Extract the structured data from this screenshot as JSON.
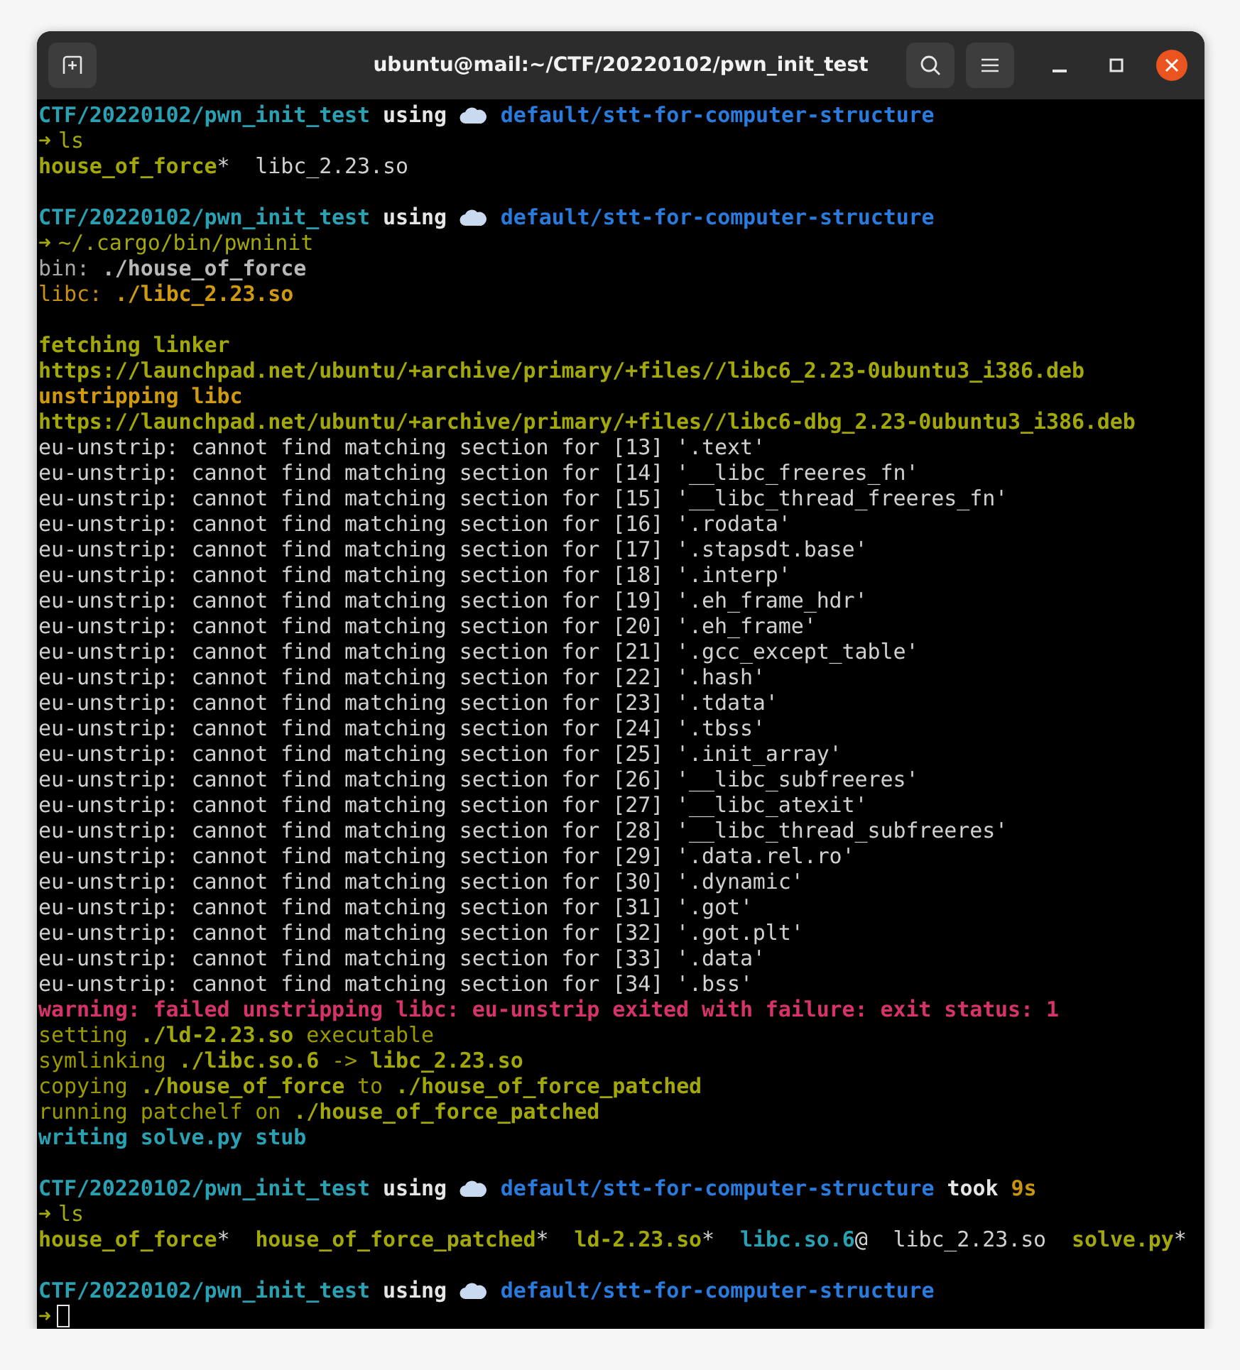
{
  "window": {
    "title": "ubuntu@mail:~/CTF/20220102/pwn_init_test"
  },
  "lines": [
    {
      "kind": "prompt",
      "parts": [
        {
          "kind": "path",
          "text": "CTF/20220102/pwn_init_test"
        },
        {
          "kind": "keyword",
          "text": "using"
        },
        {
          "kind": "cloud"
        },
        {
          "kind": "branch",
          "text": "default/stt-for-computer-structure"
        }
      ]
    },
    {
      "kind": "output",
      "parts": [
        {
          "kind": "arrow",
          "text": "➜"
        },
        {
          "kind": "command",
          "text": "ls"
        }
      ]
    },
    {
      "kind": "output",
      "parts": [
        {
          "kind": "exec",
          "text": "house_of_force"
        },
        {
          "kind": "plain",
          "text": "*  libc_2.23.so"
        }
      ]
    },
    {
      "kind": "blank"
    },
    {
      "kind": "prompt",
      "parts": [
        {
          "kind": "path",
          "text": "CTF/20220102/pwn_init_test"
        },
        {
          "kind": "keyword",
          "text": "using"
        },
        {
          "kind": "cloud"
        },
        {
          "kind": "branch",
          "text": "default/stt-for-computer-structure"
        }
      ]
    },
    {
      "kind": "output",
      "parts": [
        {
          "kind": "arrow",
          "text": "➜"
        },
        {
          "kind": "command",
          "text": "~/.cargo/bin/pwninit"
        }
      ]
    },
    {
      "kind": "output",
      "parts": [
        {
          "kind": "info",
          "text": "bin: "
        },
        {
          "kind": "info-bold",
          "text": "./house_of_force"
        }
      ]
    },
    {
      "kind": "output",
      "parts": [
        {
          "kind": "notice",
          "text": "libc: "
        },
        {
          "kind": "notice-bold",
          "text": "./libc_2.23.so"
        }
      ]
    },
    {
      "kind": "blank"
    },
    {
      "kind": "output",
      "parts": [
        {
          "kind": "out-bold",
          "text": "fetching linker"
        }
      ]
    },
    {
      "kind": "output",
      "parts": [
        {
          "kind": "out-bold",
          "text": "https://launchpad.net/ubuntu/+archive/primary/+files//libc6_2.23-0ubuntu3_i386.deb"
        }
      ]
    },
    {
      "kind": "output",
      "parts": [
        {
          "kind": "notice-bold",
          "text": "unstripping libc"
        }
      ]
    },
    {
      "kind": "output",
      "parts": [
        {
          "kind": "out-bold",
          "text": "https://launchpad.net/ubuntu/+archive/primary/+files//libc6-dbg_2.23-0ubuntu3_i386.deb"
        }
      ]
    },
    {
      "kind": "output",
      "parts": [
        {
          "kind": "plain",
          "text": "eu-unstrip: cannot find matching section for [13] '.text'"
        }
      ]
    },
    {
      "kind": "output",
      "parts": [
        {
          "kind": "plain",
          "text": "eu-unstrip: cannot find matching section for [14] '__libc_freeres_fn'"
        }
      ]
    },
    {
      "kind": "output",
      "parts": [
        {
          "kind": "plain",
          "text": "eu-unstrip: cannot find matching section for [15] '__libc_thread_freeres_fn'"
        }
      ]
    },
    {
      "kind": "output",
      "parts": [
        {
          "kind": "plain",
          "text": "eu-unstrip: cannot find matching section for [16] '.rodata'"
        }
      ]
    },
    {
      "kind": "output",
      "parts": [
        {
          "kind": "plain",
          "text": "eu-unstrip: cannot find matching section for [17] '.stapsdt.base'"
        }
      ]
    },
    {
      "kind": "output",
      "parts": [
        {
          "kind": "plain",
          "text": "eu-unstrip: cannot find matching section for [18] '.interp'"
        }
      ]
    },
    {
      "kind": "output",
      "parts": [
        {
          "kind": "plain",
          "text": "eu-unstrip: cannot find matching section for [19] '.eh_frame_hdr'"
        }
      ]
    },
    {
      "kind": "output",
      "parts": [
        {
          "kind": "plain",
          "text": "eu-unstrip: cannot find matching section for [20] '.eh_frame'"
        }
      ]
    },
    {
      "kind": "output",
      "parts": [
        {
          "kind": "plain",
          "text": "eu-unstrip: cannot find matching section for [21] '.gcc_except_table'"
        }
      ]
    },
    {
      "kind": "output",
      "parts": [
        {
          "kind": "plain",
          "text": "eu-unstrip: cannot find matching section for [22] '.hash'"
        }
      ]
    },
    {
      "kind": "output",
      "parts": [
        {
          "kind": "plain",
          "text": "eu-unstrip: cannot find matching section for [23] '.tdata'"
        }
      ]
    },
    {
      "kind": "output",
      "parts": [
        {
          "kind": "plain",
          "text": "eu-unstrip: cannot find matching section for [24] '.tbss'"
        }
      ]
    },
    {
      "kind": "output",
      "parts": [
        {
          "kind": "plain",
          "text": "eu-unstrip: cannot find matching section for [25] '.init_array'"
        }
      ]
    },
    {
      "kind": "output",
      "parts": [
        {
          "kind": "plain",
          "text": "eu-unstrip: cannot find matching section for [26] '__libc_subfreeres'"
        }
      ]
    },
    {
      "kind": "output",
      "parts": [
        {
          "kind": "plain",
          "text": "eu-unstrip: cannot find matching section for [27] '__libc_atexit'"
        }
      ]
    },
    {
      "kind": "output",
      "parts": [
        {
          "kind": "plain",
          "text": "eu-unstrip: cannot find matching section for [28] '__libc_thread_subfreeres'"
        }
      ]
    },
    {
      "kind": "output",
      "parts": [
        {
          "kind": "plain",
          "text": "eu-unstrip: cannot find matching section for [29] '.data.rel.ro'"
        }
      ]
    },
    {
      "kind": "output",
      "parts": [
        {
          "kind": "plain",
          "text": "eu-unstrip: cannot find matching section for [30] '.dynamic'"
        }
      ]
    },
    {
      "kind": "output",
      "parts": [
        {
          "kind": "plain",
          "text": "eu-unstrip: cannot find matching section for [31] '.got'"
        }
      ]
    },
    {
      "kind": "output",
      "parts": [
        {
          "kind": "plain",
          "text": "eu-unstrip: cannot find matching section for [32] '.got.plt'"
        }
      ]
    },
    {
      "kind": "output",
      "parts": [
        {
          "kind": "plain",
          "text": "eu-unstrip: cannot find matching section for [33] '.data'"
        }
      ]
    },
    {
      "kind": "output",
      "parts": [
        {
          "kind": "plain",
          "text": "eu-unstrip: cannot find matching section for [34] '.bss'"
        }
      ]
    },
    {
      "kind": "output",
      "parts": [
        {
          "kind": "error",
          "text": "warning: failed unstripping libc: eu-unstrip exited with failure: exit status: 1"
        }
      ]
    },
    {
      "kind": "output",
      "parts": [
        {
          "kind": "out",
          "text": "setting "
        },
        {
          "kind": "out-bold",
          "text": "./ld-2.23.so"
        },
        {
          "kind": "out",
          "text": " executable"
        }
      ]
    },
    {
      "kind": "output",
      "parts": [
        {
          "kind": "out",
          "text": "symlinking "
        },
        {
          "kind": "out-bold",
          "text": "./libc.so.6"
        },
        {
          "kind": "out",
          "text": " -> "
        },
        {
          "kind": "out-bold",
          "text": "libc_2.23.so"
        }
      ]
    },
    {
      "kind": "output",
      "parts": [
        {
          "kind": "out",
          "text": "copying "
        },
        {
          "kind": "out-bold",
          "text": "./house_of_force"
        },
        {
          "kind": "out",
          "text": " to "
        },
        {
          "kind": "out-bold",
          "text": "./house_of_force_patched"
        }
      ]
    },
    {
      "kind": "output",
      "parts": [
        {
          "kind": "out",
          "text": "running patchelf on "
        },
        {
          "kind": "out-bold",
          "text": "./house_of_force_patched"
        }
      ]
    },
    {
      "kind": "output",
      "parts": [
        {
          "kind": "link",
          "text": "writing solve.py stub"
        }
      ]
    },
    {
      "kind": "blank"
    },
    {
      "kind": "prompt",
      "parts": [
        {
          "kind": "path",
          "text": "CTF/20220102/pwn_init_test"
        },
        {
          "kind": "keyword",
          "text": "using"
        },
        {
          "kind": "cloud"
        },
        {
          "kind": "branch",
          "text": "default/stt-for-computer-structure"
        },
        {
          "kind": "keyword",
          "text": "took"
        },
        {
          "kind": "duration",
          "text": "9s"
        }
      ]
    },
    {
      "kind": "output",
      "parts": [
        {
          "kind": "arrow",
          "text": "➜"
        },
        {
          "kind": "command",
          "text": "ls"
        }
      ]
    },
    {
      "kind": "output",
      "parts": [
        {
          "kind": "exec",
          "text": "house_of_force"
        },
        {
          "kind": "plain",
          "text": "*  "
        },
        {
          "kind": "exec",
          "text": "house_of_force_patched"
        },
        {
          "kind": "plain",
          "text": "*  "
        },
        {
          "kind": "exec",
          "text": "ld-2.23.so"
        },
        {
          "kind": "plain",
          "text": "*  "
        },
        {
          "kind": "link",
          "text": "libc.so.6"
        },
        {
          "kind": "plain",
          "text": "@  libc_2.23.so  "
        },
        {
          "kind": "exec",
          "text": "solve.py"
        },
        {
          "kind": "plain",
          "text": "*"
        }
      ]
    },
    {
      "kind": "blank"
    },
    {
      "kind": "prompt",
      "parts": [
        {
          "kind": "path",
          "text": "CTF/20220102/pwn_init_test"
        },
        {
          "kind": "keyword",
          "text": "using"
        },
        {
          "kind": "cloud"
        },
        {
          "kind": "branch",
          "text": "default/stt-for-computer-structure"
        }
      ]
    },
    {
      "kind": "input",
      "parts": [
        {
          "kind": "arrow",
          "text": "➜"
        },
        {
          "kind": "cursor"
        }
      ]
    }
  ]
}
